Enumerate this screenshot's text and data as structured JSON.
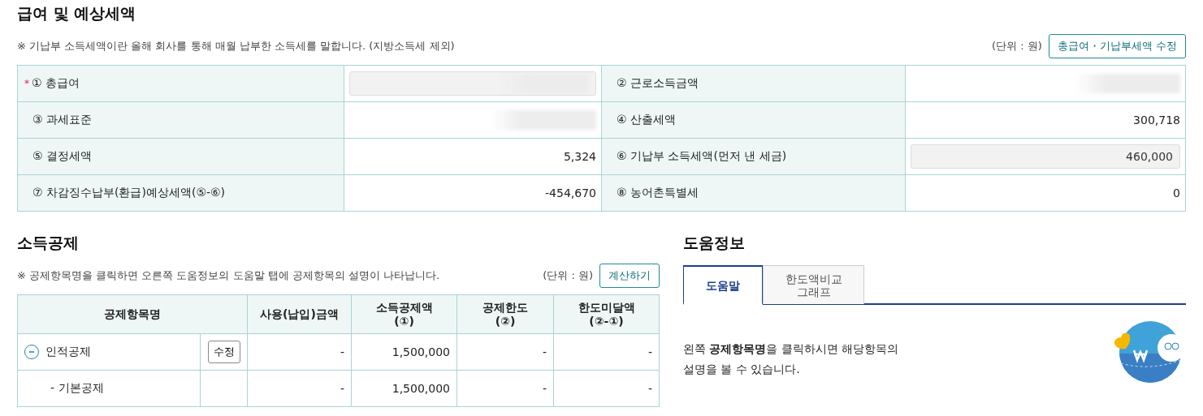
{
  "summary": {
    "title": "급여 및 예상세액",
    "note": "※ 기납부 소득세액이란 올해 회사를 통해 매월 납부한 소득세를 말합니다. (지방소득세 제외)",
    "unit": "(단위 : 원)",
    "edit_button": "총급여・기납부세액 수정",
    "required_mark": "*",
    "rows": [
      [
        {
          "label": "① 총급여",
          "required": true,
          "kind": "redacted-input"
        },
        {
          "label": "② 근로소득금액",
          "required": false,
          "kind": "redacted"
        }
      ],
      [
        {
          "label": "③ 과세표준",
          "required": false,
          "kind": "redacted"
        },
        {
          "label": "④ 산출세액",
          "required": false,
          "kind": "text",
          "value": "300,718"
        }
      ],
      [
        {
          "label": "⑤ 결정세액",
          "required": false,
          "kind": "text",
          "value": "5,324"
        },
        {
          "label": "⑥ 기납부 소득세액(먼저 낸 세금)",
          "required": false,
          "kind": "input",
          "value": "460,000"
        }
      ],
      [
        {
          "label": "⑦ 차감징수납부(환급)예상세액(⑤-⑥)",
          "required": false,
          "kind": "text",
          "value": "-454,670"
        },
        {
          "label": "⑧ 농어촌특별세",
          "required": false,
          "kind": "text",
          "value": "0"
        }
      ]
    ]
  },
  "deductions": {
    "title": "소득공제",
    "note": "※ 공제항목명을 클릭하면 오른쪽 도움정보의 도움말 탭에 공제항목의 설명이 나타납니다.",
    "unit": "(단위 : 원)",
    "calc_button": "계산하기",
    "columns": [
      "공제항목명",
      "사용(납입)금액",
      "소득공제액\n(①)",
      "공제한도\n(②)",
      "한도미달액\n(②-①)"
    ],
    "rows": [
      {
        "name": "인적공제",
        "expanded": true,
        "button": "수정",
        "used": "-",
        "deduction": "1,500,000",
        "limit": "-",
        "remaining": "-",
        "children": [
          {
            "name": "- 기본공제",
            "used": "-",
            "deduction": "1,500,000",
            "limit": "-",
            "remaining": "-"
          }
        ]
      }
    ]
  },
  "help": {
    "title": "도움정보",
    "tabs": [
      {
        "label": "도움말",
        "selected": true
      },
      {
        "label": "한도액비교\n그래프",
        "selected": false
      }
    ],
    "text": "왼쪽 **공제항목명**을 클릭하시면 해당항목의 설명을 볼 수 있습니다."
  }
}
